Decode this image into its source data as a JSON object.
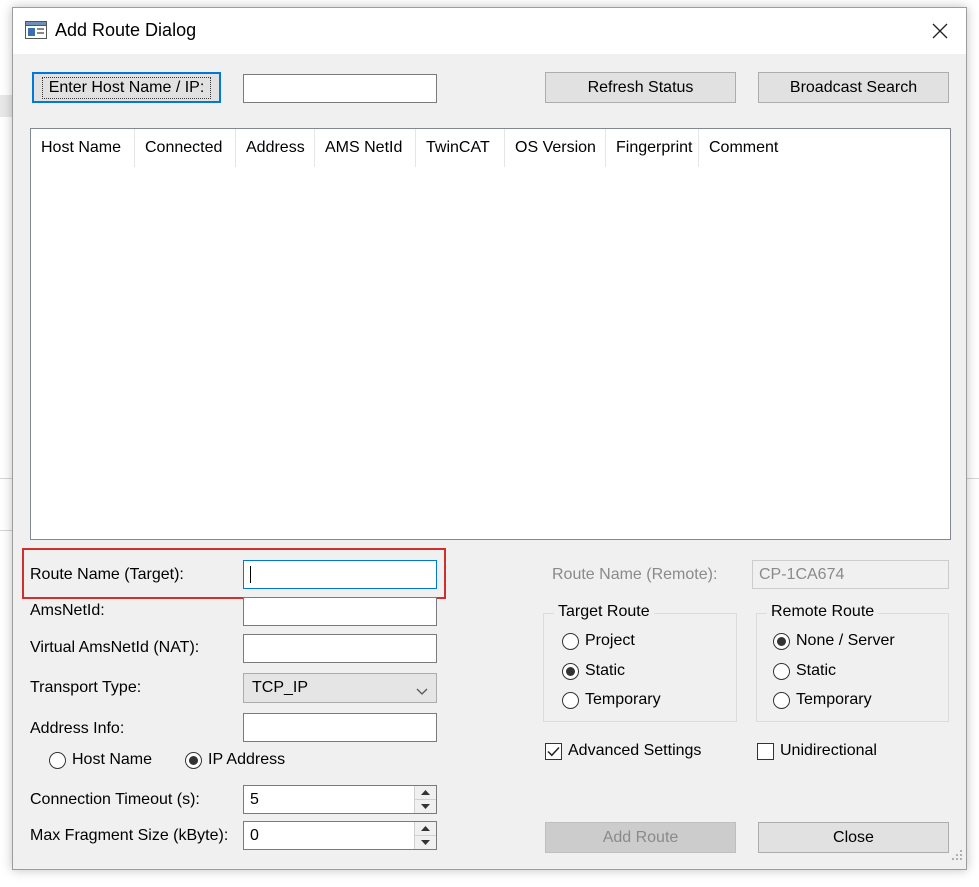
{
  "window": {
    "title": "Add Route Dialog"
  },
  "top": {
    "enter_host_label": "Enter Host Name / IP:",
    "host_value": "",
    "refresh_label": "Refresh Status",
    "broadcast_label": "Broadcast Search"
  },
  "list": {
    "columns": [
      "Host Name",
      "Connected",
      "Address",
      "AMS NetId",
      "TwinCAT",
      "OS Version",
      "Fingerprint",
      "Comment"
    ]
  },
  "form": {
    "route_name_label": "Route Name (Target):",
    "route_name_value": "",
    "amsnetid_label": "AmsNetId:",
    "amsnetid_value": "",
    "virtual_label": "Virtual AmsNetId (NAT):",
    "virtual_value": "",
    "transport_label": "Transport Type:",
    "transport_value": "TCP_IP",
    "address_label": "Address Info:",
    "address_value": "",
    "host_name_radio": "Host Name",
    "ip_address_radio": "IP Address",
    "timeout_label": "Connection Timeout (s):",
    "timeout_value": "5",
    "fragment_label": "Max Fragment Size (kByte):",
    "fragment_value": "0"
  },
  "remote": {
    "route_name_remote_label": "Route Name (Remote):",
    "route_name_remote_value": "CP-1CA674"
  },
  "target_route": {
    "title": "Target Route",
    "options": [
      "Project",
      "Static",
      "Temporary"
    ],
    "selected": "Static"
  },
  "remote_route": {
    "title": "Remote Route",
    "options": [
      "None / Server",
      "Static",
      "Temporary"
    ],
    "selected": "None / Server"
  },
  "options": {
    "advanced_label": "Advanced Settings",
    "advanced_checked": true,
    "unidirectional_label": "Unidirectional",
    "unidirectional_checked": false
  },
  "actions": {
    "add_route_label": "Add Route",
    "close_label": "Close"
  },
  "colors": {
    "dialog_bg": "#f0f0f0",
    "focus_blue": "#0078d7",
    "highlight_red": "#d12e2e"
  }
}
